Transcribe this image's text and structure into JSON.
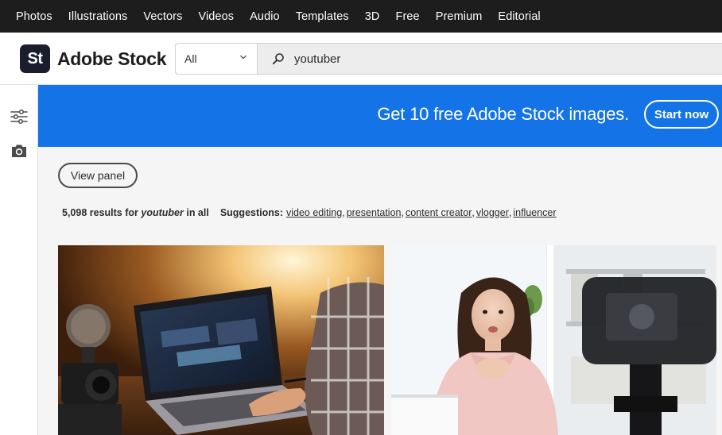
{
  "topnav": {
    "items": [
      "Photos",
      "Illustrations",
      "Vectors",
      "Videos",
      "Audio",
      "Templates",
      "3D",
      "Free",
      "Premium",
      "Editorial"
    ]
  },
  "header": {
    "logo_mark": "St",
    "logo_text": "Adobe Stock",
    "search": {
      "filter_value": "All",
      "query": "youtuber"
    }
  },
  "banner": {
    "text": "Get 10 free Adobe Stock images.",
    "button": "Start now"
  },
  "main": {
    "view_panel": "View panel",
    "results": {
      "count_text": "5,098 results for",
      "query": "youtuber",
      "scope": "in all",
      "suggestions_label": "Suggestions:",
      "suggestions": [
        "video editing",
        "presentation",
        "content creator",
        "vlogger",
        "influencer"
      ]
    }
  },
  "icons": {
    "rail": [
      "filter-sliders-icon",
      "camera-icon"
    ],
    "search": "search-icon",
    "dropdown": "chevron-down-icon"
  },
  "colors": {
    "topnav_bg": "#1d1d1d",
    "banner_bg": "#1473e6",
    "logo_bg": "#1a1d2d"
  }
}
